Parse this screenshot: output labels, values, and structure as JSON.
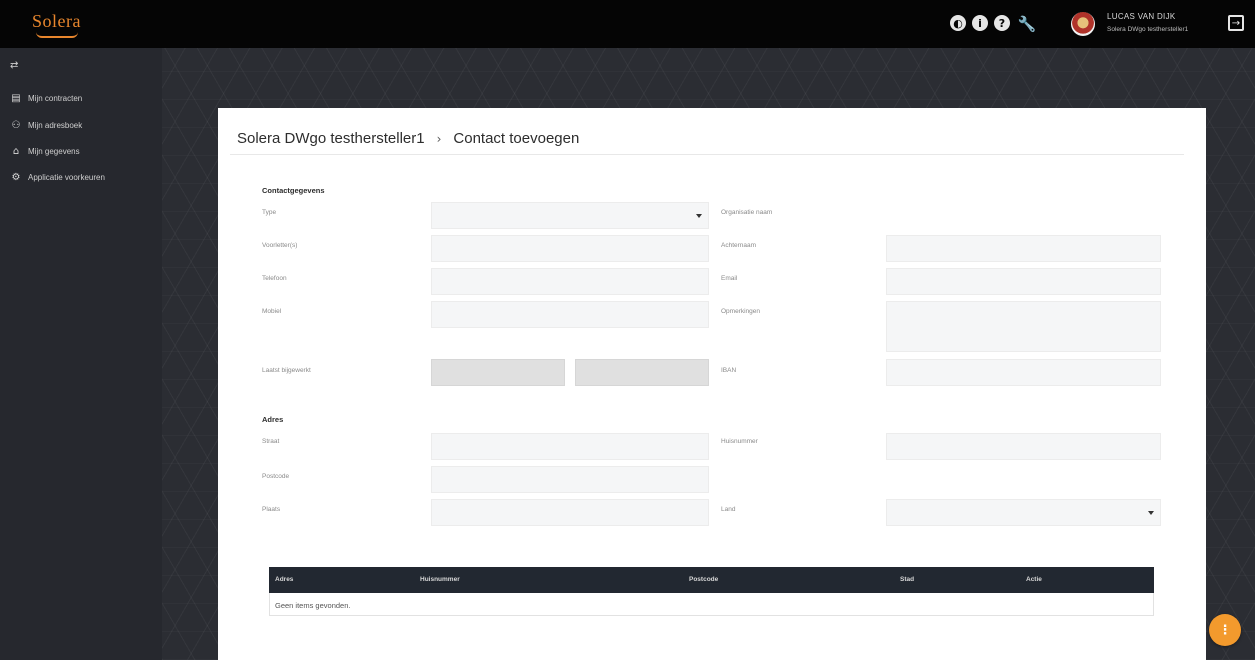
{
  "header": {
    "logo": "Solera",
    "user": {
      "name": "LUCAS VAN DIJK",
      "org": "Solera DWgo testhersteller1"
    },
    "icons": [
      "contrast-icon",
      "info-icon",
      "help-icon",
      "wrench-icon",
      "logout-icon"
    ]
  },
  "sidebar": {
    "toggle_icon": "swap-arrows-icon",
    "items": [
      {
        "label": "Mijn contracten",
        "icon": "contract-icon"
      },
      {
        "label": "Mijn adresboek",
        "icon": "address-book-icon"
      },
      {
        "label": "Mijn gegevens",
        "icon": "home-icon"
      },
      {
        "label": "Applicatie voorkeuren",
        "icon": "gear-icon"
      }
    ]
  },
  "breadcrumb": {
    "parent": "Solera DWgo testhersteller1",
    "separator": "›",
    "current": "Contact toevoegen"
  },
  "contact": {
    "title": "Contactgegevens",
    "type_label": "Type",
    "type_value": "",
    "org_label": "Organisatie naam",
    "initials_label": "Voorletter(s)",
    "lastname_label": "Achternaam",
    "phone_label": "Telefoon",
    "email_label": "Email",
    "mobile_label": "Mobiel",
    "remarks_label": "Opmerkingen",
    "updated_label": "Laatst bijgewerkt",
    "iban_label": "IBAN"
  },
  "address": {
    "title": "Adres",
    "street_label": "Straat",
    "housenr_label": "Huisnummer",
    "postcode_label": "Postcode",
    "city_label": "Plaats",
    "country_label": "Land",
    "country_value": ""
  },
  "table": {
    "columns": [
      "Adres",
      "Huisnummer",
      "Postcode",
      "Stad",
      "Actie"
    ],
    "empty_text": "Geen items gevonden."
  },
  "fab": {
    "label": "⋮"
  },
  "colors": {
    "accent": "#f39a2d",
    "logo": "#e8862d",
    "table_header": "#222831",
    "sidebar": "#26282e"
  }
}
